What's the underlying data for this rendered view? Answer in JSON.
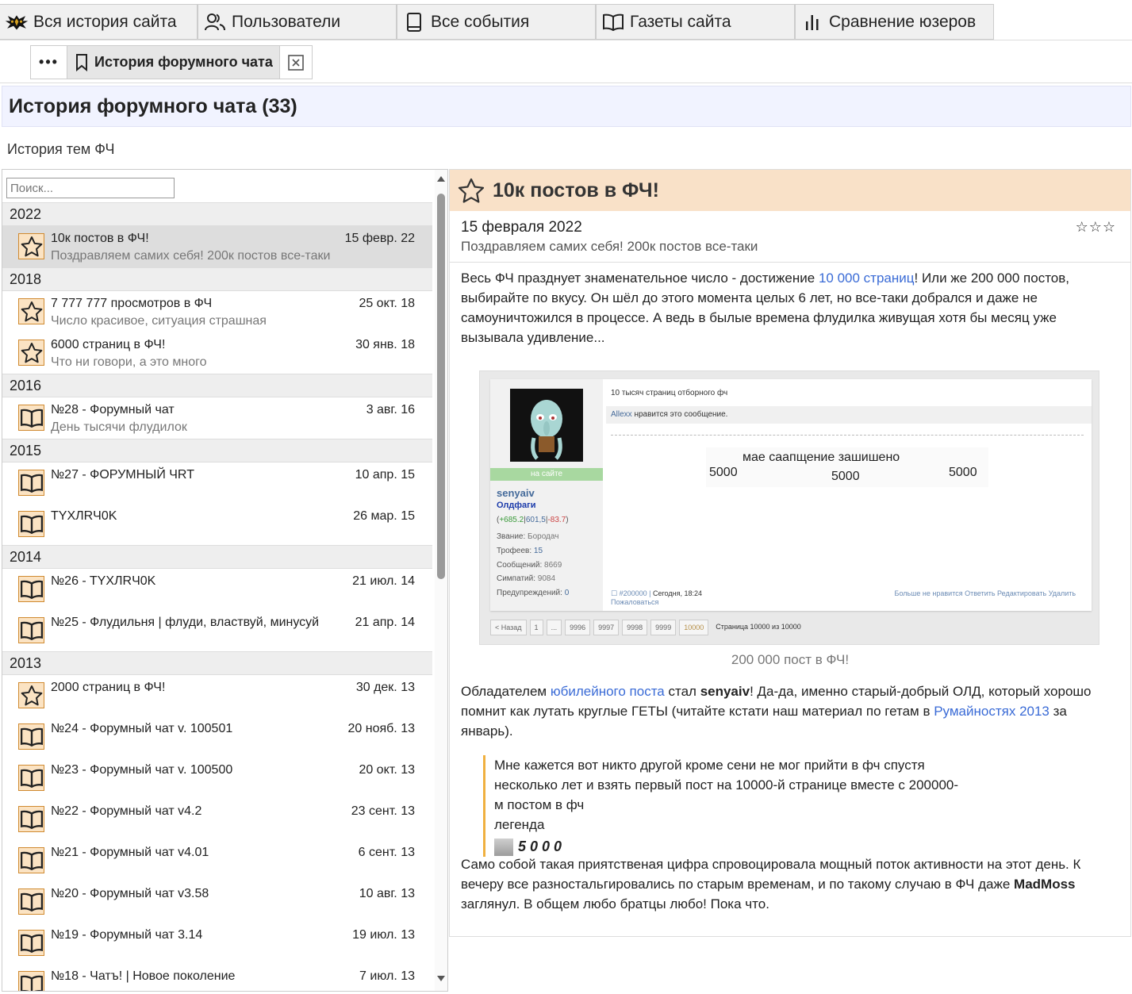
{
  "nav": {
    "tabs": [
      {
        "label": "Вся история сайта",
        "icon": "site-logo-icon"
      },
      {
        "label": "Пользователи",
        "icon": "users-icon"
      },
      {
        "label": "Все события",
        "icon": "book-icon"
      },
      {
        "label": "Газеты сайта",
        "icon": "open-book-icon"
      },
      {
        "label": "Сравнение юзеров",
        "icon": "bar-chart-icon"
      }
    ]
  },
  "subtabs": {
    "more_label": "•••",
    "active_label": "История форумного чата"
  },
  "page": {
    "title": "История форумного чата (33)",
    "subtitle": "История тем ФЧ"
  },
  "search": {
    "placeholder": "Поиск..."
  },
  "list": [
    {
      "year": "2022",
      "items": [
        {
          "icon": "star",
          "title": "10к постов в ФЧ!",
          "date": "15 февр. 22",
          "desc": "Поздравляем самих себя! 200к постов все-таки",
          "selected": true
        }
      ]
    },
    {
      "year": "2018",
      "items": [
        {
          "icon": "star",
          "title": "7 777 777 просмотров в ФЧ",
          "date": "25 окт. 18",
          "desc": "Число красивое, ситуация страшная"
        },
        {
          "icon": "star",
          "title": "6000 страниц в ФЧ!",
          "date": "30 янв. 18",
          "desc": "Что ни говори, а это много"
        }
      ]
    },
    {
      "year": "2016",
      "items": [
        {
          "icon": "book",
          "title": "№28 - Форумный чат",
          "date": "3 авг. 16",
          "desc": "День тысячи флудилок"
        }
      ]
    },
    {
      "year": "2015",
      "items": [
        {
          "icon": "book",
          "title": "№27 - ФОРУМНЫЙ ЧRT",
          "date": "10 апр. 15",
          "desc": ""
        },
        {
          "icon": "book",
          "title": "TYXЛRЧ0K",
          "date": "26 мар. 15",
          "desc": ""
        }
      ]
    },
    {
      "year": "2014",
      "items": [
        {
          "icon": "book",
          "title": "№26 - TYXЛRЧ0K",
          "date": "21 июл. 14",
          "desc": ""
        },
        {
          "icon": "book",
          "title": "№25 - Флудильня | флуди, властвуй, минусуй",
          "date": "21 апр. 14",
          "desc": ""
        }
      ]
    },
    {
      "year": "2013",
      "items": [
        {
          "icon": "star",
          "title": "2000 страниц в ФЧ!",
          "date": "30 дек. 13",
          "desc": ""
        },
        {
          "icon": "book",
          "title": "№24 - Форумный чат v. 100501",
          "date": "20 нояб. 13",
          "desc": ""
        },
        {
          "icon": "book",
          "title": "№23 - Форумный чат v. 100500",
          "date": "20 окт. 13",
          "desc": ""
        },
        {
          "icon": "book",
          "title": "№22 - Форумный чат v4.2",
          "date": "23 сент. 13",
          "desc": ""
        },
        {
          "icon": "book",
          "title": "№21 - Форумный чат v4.01",
          "date": "6 сент. 13",
          "desc": ""
        },
        {
          "icon": "book",
          "title": "№20 - Форумный чат v3.58",
          "date": "10 авг. 13",
          "desc": ""
        },
        {
          "icon": "book",
          "title": "№19 - Форумный чат 3.14",
          "date": "19 июл. 13",
          "desc": ""
        },
        {
          "icon": "book",
          "title": "№18 - Чатъ! | Новое поколение",
          "date": "7 июл. 13",
          "desc": ""
        }
      ]
    }
  ],
  "article": {
    "title": "10к постов в ФЧ!",
    "date": "15 февраля 2022",
    "stars": "☆☆☆",
    "subtitle": "Поздравляем самих себя! 200к постов все-таки",
    "p1_a": "Весь ФЧ празднует знаменательное число - достижение ",
    "p1_link": "10 000 страниц",
    "p1_b": "! Или же 200 000 постов, выбирайте по вкусу. Он шёл до этого момента целых 6 лет, но все-таки добрался и даже не самоуничтожился в процессе. А ведь в былые времена флудилка живущая хотя бы месяц уже вызывала удивление...",
    "image": {
      "msg_title": "10 тысяч страниц отборного фч",
      "likes_user": "Allexx",
      "likes_text": " нравится это сообщение.",
      "online": "на сайте",
      "username": "senyaiv",
      "rank": "Олдфаги",
      "rep_plus": "+685.2",
      "rep_mid": "601,5",
      "rep_minus": "-83.7",
      "rank_label": "Звание:",
      "rank_value": "Бородач",
      "trophies_label": "Трофеев:",
      "trophies_value": "15",
      "posts_label": "Сообщений:",
      "posts_value": "8669",
      "sympathy_label": "Симпатий:",
      "sympathy_value": "9084",
      "warnings_label": "Предупреждений:",
      "warnings_value": "0",
      "meme_line": "мае саапщение зашишено",
      "meme_n1": "5000",
      "meme_n2": "5000",
      "meme_n3": "5000",
      "post_id": "#200000",
      "post_time": "Сегодня, 18:24",
      "actions": "Больше не нравится   Ответить   Редактировать   Удалить   Пожаловаться",
      "pager": [
        "< Назад",
        "1",
        "...",
        "9996",
        "9997",
        "9998",
        "9999",
        "10000"
      ],
      "pager_text": "Страница 10000 из 10000"
    },
    "caption": "200 000 пост в ФЧ!",
    "p2_a": "Обладателем ",
    "p2_link1": "юбилейного поста",
    "p2_b": " стал ",
    "p2_bold": "senyaiv",
    "p2_c": "! Да-да, именно старый-добрый ОЛД, который хорошо помнит как лутать круглые ГЕТЫ (читайте кстати наш материал по гетам в ",
    "p2_link2": "Румайностях 2013",
    "p2_d": " за январь).",
    "quote_l1": "Мне кажется вот никто другой кроме сени не мог прийти в фч спустя несколько лет и взять первый пост на 10000-й странице вместе с 200000-м постом в фч",
    "quote_l2": "легенда",
    "quote_sig": "5000",
    "p3_a": "Само собой такая приятственая цифра спровоцировала мощный поток активности на этот день. К вечеру все разностальгировались по старым временам, и по такому случаю в ФЧ даже ",
    "p3_bold": "MadMoss",
    "p3_b": " заглянул. В общем любо братцы любо! Пока что."
  },
  "colors": {
    "icon_border": "#d08a30",
    "icon_bg": "#fbe3c3",
    "article_header_bg": "#f9e1c8",
    "link": "#3a6bd6",
    "quote_bar": "#f0b040"
  }
}
